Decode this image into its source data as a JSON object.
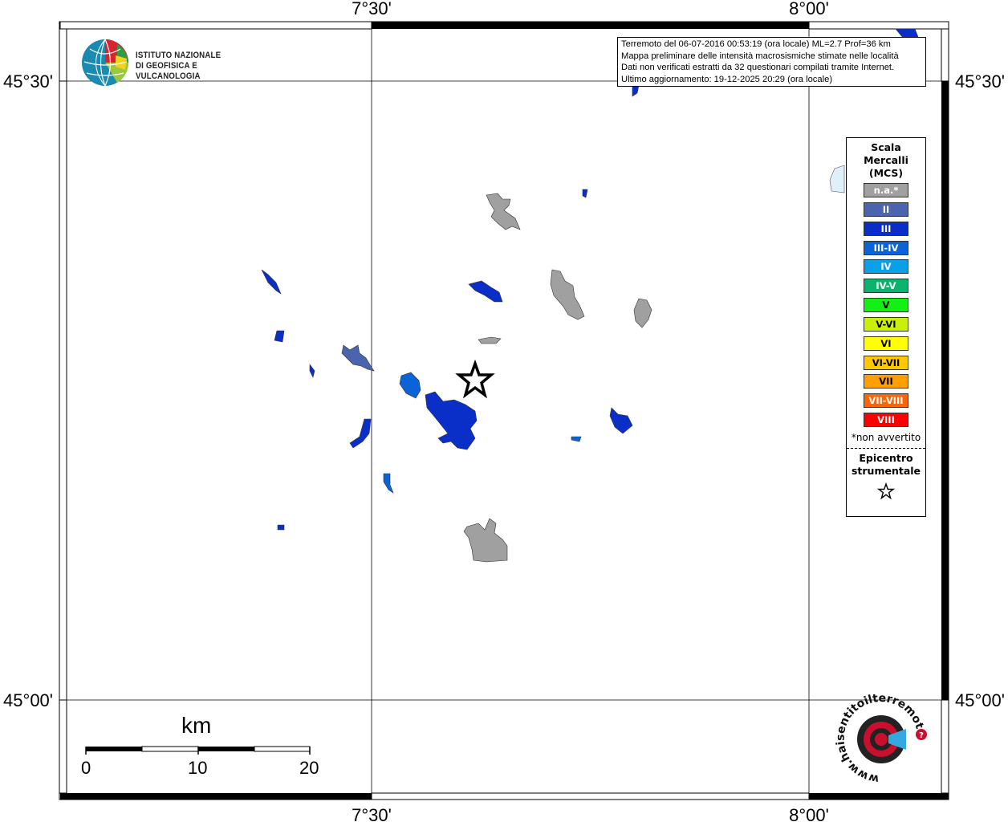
{
  "map": {
    "lon_labels": [
      "7°30'",
      "8°00'"
    ],
    "lat_labels": [
      "45°30'",
      "45°00'"
    ]
  },
  "logo": {
    "line1": "ISTITUTO NAZIONALE",
    "line2": "DI GEOFISICA E VULCANOLOGIA"
  },
  "info": {
    "line1": "Terremoto del 06-07-2016 00:53:19 (ora locale) ML=2.7 Prof=36 km",
    "line2": "Mappa preliminare delle intensità macrosismiche stimate nelle località",
    "line3": "Dati non verificati estratti da 32 questionari compilati tramite Internet.",
    "line4": "Ultimo aggiornamento: 19-12-2025 20:29 (ora locale)"
  },
  "legend": {
    "title_line1": "Scala",
    "title_line2": "Mercalli",
    "title_line3": "(MCS)",
    "items": [
      {
        "label": "n.a.*",
        "color": "#a0a0a0",
        "text": "#ffffff"
      },
      {
        "label": "II",
        "color": "#4a64b0",
        "text": "#ffffff"
      },
      {
        "label": "III",
        "color": "#0a2fc8",
        "text": "#ffffff"
      },
      {
        "label": "III-IV",
        "color": "#0a64d8",
        "text": "#ffffff"
      },
      {
        "label": "IV",
        "color": "#0aa0e8",
        "text": "#ffffff"
      },
      {
        "label": "IV-V",
        "color": "#0ab46e",
        "text": "#ffffff"
      },
      {
        "label": "V",
        "color": "#14f014",
        "text": "#000000"
      },
      {
        "label": "V-VI",
        "color": "#c8f00a",
        "text": "#000000"
      },
      {
        "label": "VI",
        "color": "#ffff00",
        "text": "#000000"
      },
      {
        "label": "VI-VII",
        "color": "#ffc800",
        "text": "#000000"
      },
      {
        "label": "VII",
        "color": "#ffa000",
        "text": "#000000"
      },
      {
        "label": "VII-VIII",
        "color": "#ff6400",
        "text": "#ffffff"
      },
      {
        "label": "VIII",
        "color": "#ff0000",
        "text": "#ffffff"
      }
    ],
    "note": "*non avvertito",
    "epicenter_line1": "Epicentro",
    "epicenter_line2": "strumentale"
  },
  "scale_bar": {
    "unit": "km",
    "ticks": [
      "0",
      "10",
      "20"
    ]
  },
  "hst_logo": {
    "text": "www.haisentitoilterremoto.it"
  }
}
